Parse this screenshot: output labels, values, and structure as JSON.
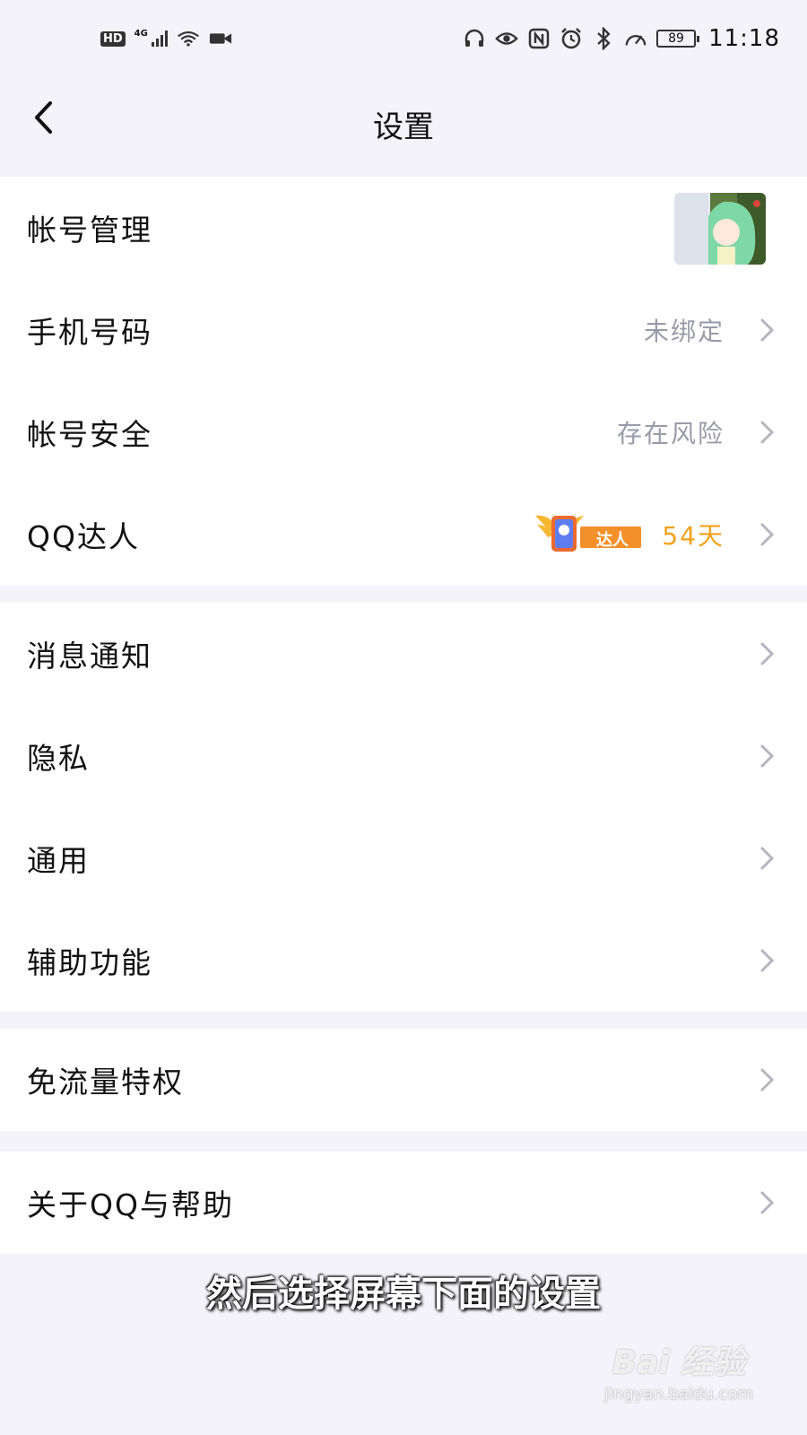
{
  "statusbar": {
    "hd": "HD",
    "network": "4G",
    "battery": "89",
    "time": "11:18",
    "icons": [
      "wifi-icon",
      "video-camera-icon",
      "headset-icon",
      "eye-icon",
      "nfc-icon",
      "alarm-icon",
      "bluetooth-icon",
      "speedometer-icon"
    ]
  },
  "nav": {
    "title": "设置"
  },
  "groups": [
    {
      "items": [
        {
          "label": "帐号管理"
        },
        {
          "label": "手机号码",
          "value": "未绑定"
        },
        {
          "label": "帐号安全",
          "value": "存在风险"
        },
        {
          "label": "QQ达人",
          "badge": "达人",
          "value": "54天"
        }
      ]
    },
    {
      "items": [
        {
          "label": "消息通知"
        },
        {
          "label": "隐私"
        },
        {
          "label": "通用"
        },
        {
          "label": "辅助功能"
        }
      ]
    },
    {
      "items": [
        {
          "label": "免流量特权"
        }
      ]
    },
    {
      "items": [
        {
          "label": "关于QQ与帮助"
        }
      ]
    }
  ],
  "overlay": {
    "caption": "然后选择屏幕下面的设置",
    "watermark_logo": "Bai 经验",
    "watermark_url": "jingyan.baidu.com"
  },
  "colors": {
    "background": "#f3f3f9",
    "accent_orange": "#f2a21b",
    "value_gray": "#9a9aa8"
  }
}
